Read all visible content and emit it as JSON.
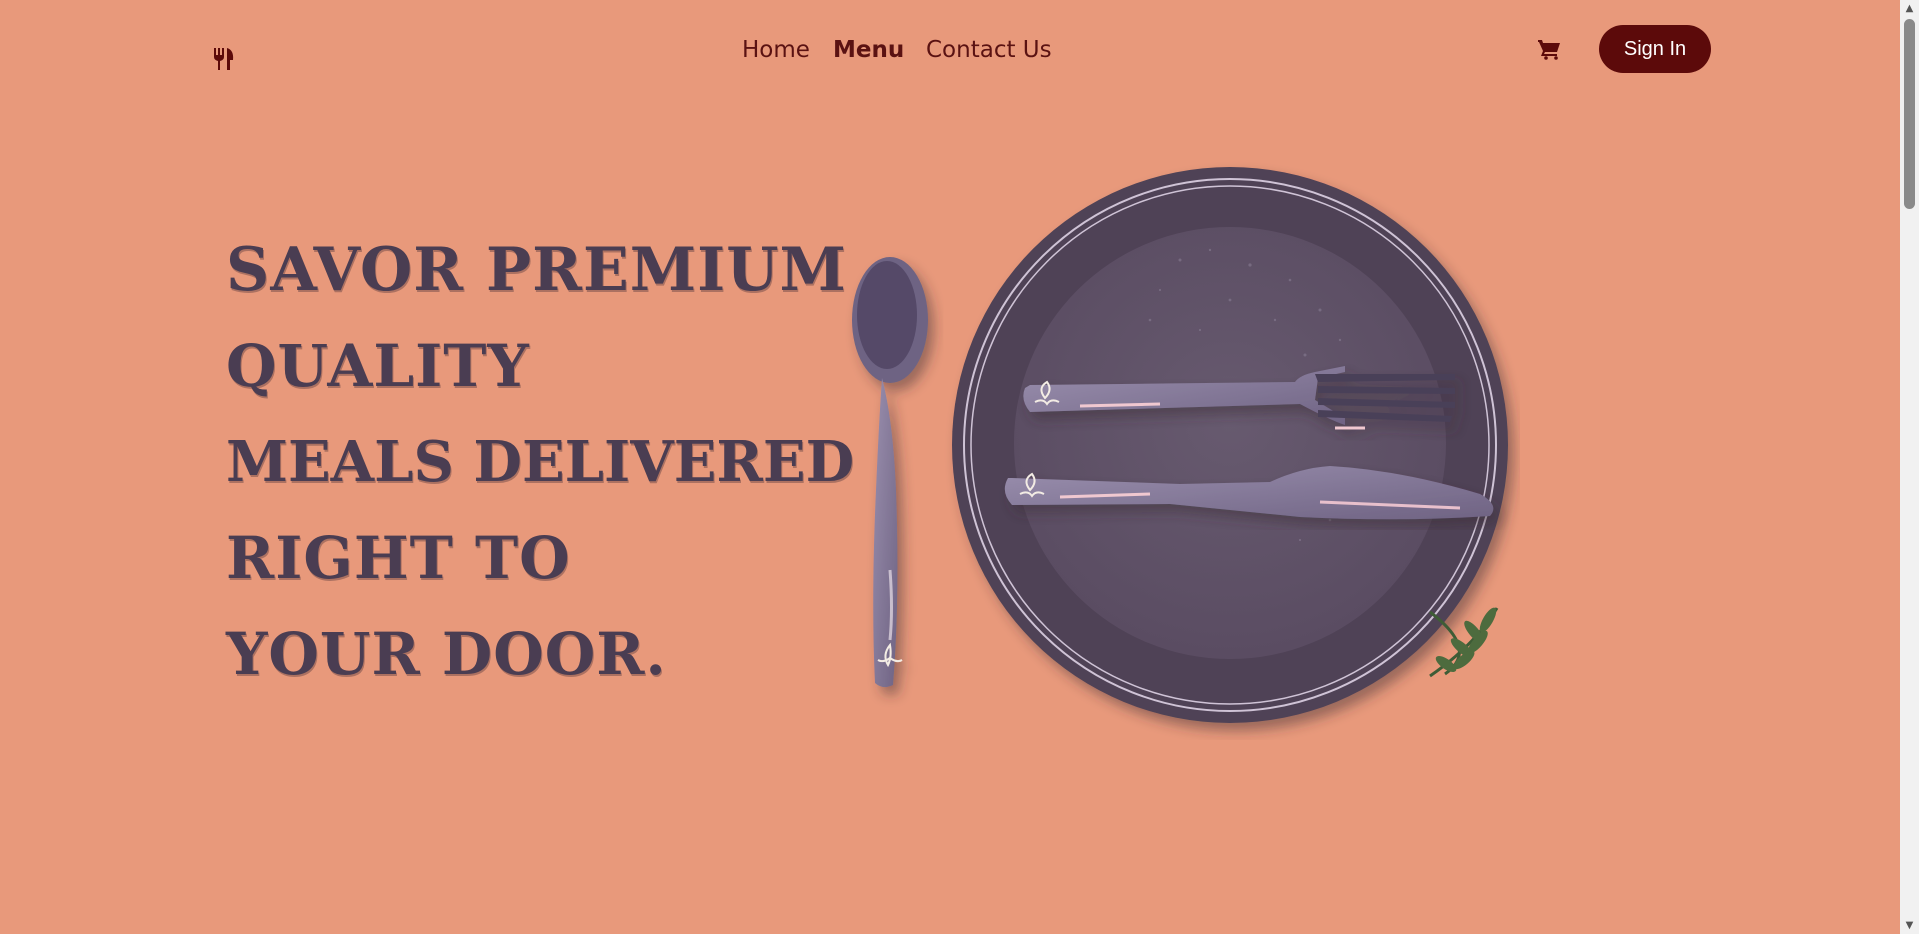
{
  "header": {
    "logo_icon": "fork-knife-icon",
    "nav": [
      {
        "label": "Home",
        "active": false
      },
      {
        "label": "Menu",
        "active": true
      },
      {
        "label": "Contact Us",
        "active": false
      }
    ],
    "cart_icon": "cart-icon",
    "signin_label": "Sign In"
  },
  "hero": {
    "lines": [
      "Savor premium",
      "quality",
      "meals delivered",
      "right to",
      "your door."
    ]
  },
  "colors": {
    "background": "#e8997b",
    "brand": "#5c0a0a",
    "headline": "#4a3d52",
    "plate": "#4f4256"
  },
  "illustration": {
    "items": [
      "spoon-icon",
      "plate",
      "fork-icon",
      "knife-icon",
      "leaf-sprig"
    ]
  }
}
